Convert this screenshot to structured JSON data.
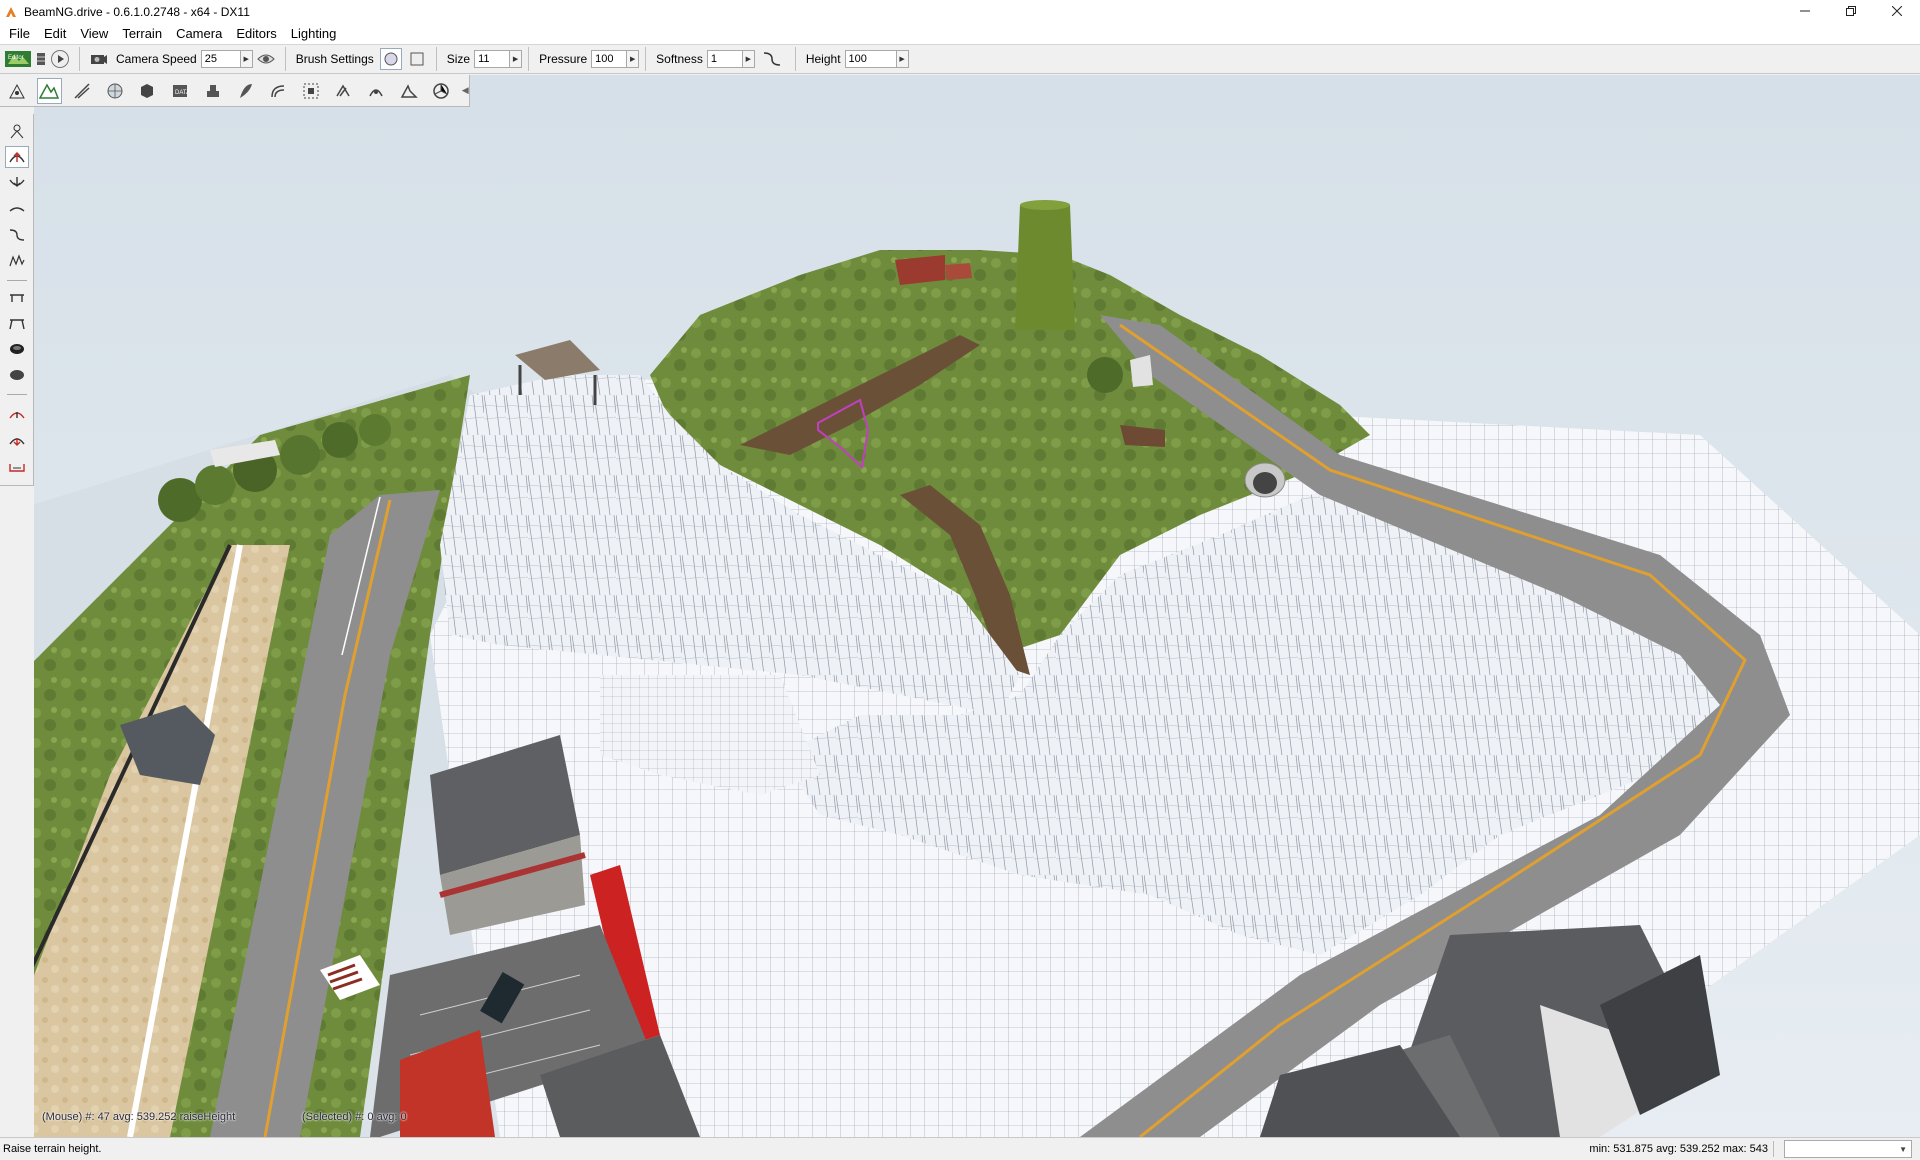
{
  "window": {
    "title": "BeamNG.drive - 0.6.1.0.2748 - x64 - DX11",
    "minimize_icon": "minimize-icon",
    "maximize_icon": "restore-icon",
    "close_icon": "close-icon"
  },
  "menu": {
    "items": [
      {
        "label": "File"
      },
      {
        "label": "Edit"
      },
      {
        "label": "View"
      },
      {
        "label": "Terrain"
      },
      {
        "label": "Camera"
      },
      {
        "label": "Editors"
      },
      {
        "label": "Lighting"
      }
    ]
  },
  "toolbar": {
    "camera_speed_label": "Camera Speed",
    "camera_speed_value": "25",
    "brush_settings_label": "Brush Settings",
    "size_label": "Size",
    "size_value": "11",
    "pressure_label": "Pressure",
    "pressure_value": "100",
    "softness_label": "Softness",
    "softness_value": "1",
    "height_label": "Height",
    "height_value": "100"
  },
  "terrain_tools": {
    "icons": [
      "select-objects-icon",
      "terrain-editor-icon",
      "road-editor-icon",
      "terrain-painter-icon",
      "object-palette-icon",
      "datablock-icon",
      "vehicle-icon",
      "forest-editor-icon",
      "decal-road-icon",
      "mesh-road-icon",
      "river-editor-icon",
      "navmesh-icon",
      "sound-emitter-icon",
      "particle-icon"
    ],
    "active_index": 1
  },
  "brush_palette": {
    "icons": [
      "grab-terrain-icon",
      "raise-height-icon",
      "lower-height-icon",
      "smooth-icon",
      "smooth-slope-icon",
      "paint-noise-icon",
      "flatten-icon",
      "set-height-icon",
      "clear-terrain-icon",
      "restore-terrain-icon",
      "set-empty-icon",
      "alpha-icon",
      "raise-icon"
    ],
    "active_index": 1
  },
  "viewport": {
    "mouse_info": "(Mouse) #: 47  avg: 539.252 raiseHeight",
    "selected_info": "(Selected) #: 0  avg: 0"
  },
  "status": {
    "message": "Raise terrain height.",
    "stats": "min: 531.875  avg: 539.252  max: 543"
  },
  "colors": {
    "sky": "#dde6ed",
    "grass": "#6d8a3a",
    "terrain_wire": "#f4f6fa",
    "road": "#8d8d8d",
    "road_stripe": "#e0a030",
    "sand": "#d9c39a",
    "selection": "#c040c0"
  }
}
